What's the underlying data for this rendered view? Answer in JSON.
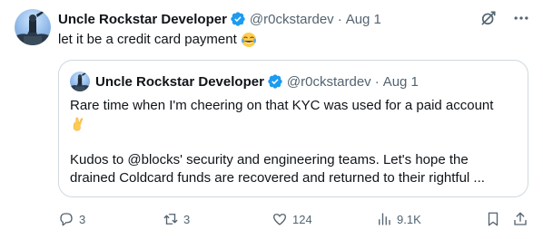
{
  "tweet": {
    "author_name": "Uncle Rockstar Developer",
    "handle": "@r0ckstardev",
    "separator": "·",
    "date": "Aug 1",
    "text": "let it be a credit card payment",
    "emoji": "tears-of-joy-emoji"
  },
  "quoted_tweet": {
    "author_name": "Uncle Rockstar Developer",
    "handle": "@r0ckstardev",
    "separator": "·",
    "date": "Aug 1",
    "line1": "Rare time when I'm cheering on that KYC was used for a paid account",
    "emoji": "crossed-fingers-emoji",
    "paragraph2": "Kudos to @blocks' security and engineering teams. Let's hope the drained Coldcard funds are recovered and returned to their rightful ..."
  },
  "actions": {
    "replies": "3",
    "reposts": "3",
    "likes": "124",
    "views": "9.1K"
  },
  "colors": {
    "text": "#0f1419",
    "secondary": "#536471",
    "verified": "#1d9bf0",
    "border": "#cfd9de"
  },
  "icons": [
    "verified-badge-icon",
    "grok-icon",
    "more-icon",
    "reply-icon",
    "repost-icon",
    "like-icon",
    "views-icon",
    "bookmark-icon",
    "share-icon"
  ]
}
